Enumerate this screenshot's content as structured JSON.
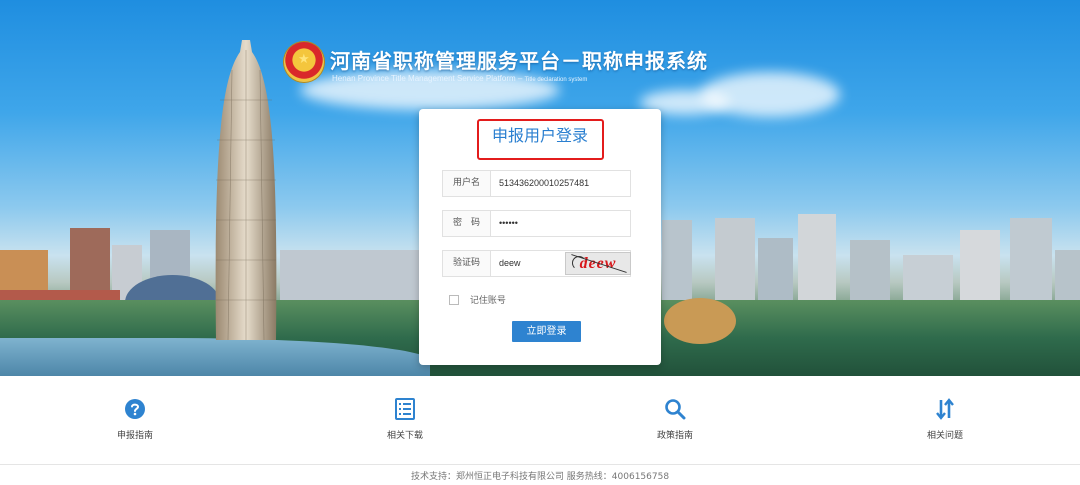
{
  "site": {
    "title": "河南省职称管理服务平台－职称申报系统",
    "subtitle": "Henan Province Title Management Service Platform",
    "subtitle_small": "Title declaration system"
  },
  "login": {
    "heading": "申报用户登录",
    "username_label": "用户名",
    "username_value": "513436200010257481",
    "password_label": "密　码",
    "password_value": "••••••",
    "captcha_label": "验证码",
    "captcha_value": "deew",
    "captcha_image_text": "deew",
    "remember_label": "记住账号",
    "submit_label": "立即登录"
  },
  "nav": [
    {
      "label": "申报指南",
      "icon": "question-circle-icon"
    },
    {
      "label": "相关下载",
      "icon": "document-list-icon"
    },
    {
      "label": "政策指南",
      "icon": "search-icon"
    },
    {
      "label": "相关问题",
      "icon": "sort-arrows-icon"
    }
  ],
  "footer": "技术支持：郑州恒正电子科技有限公司 服务热线：4006156758",
  "colors": {
    "accent": "#2e83d0",
    "highlight": "#e31c1c"
  }
}
